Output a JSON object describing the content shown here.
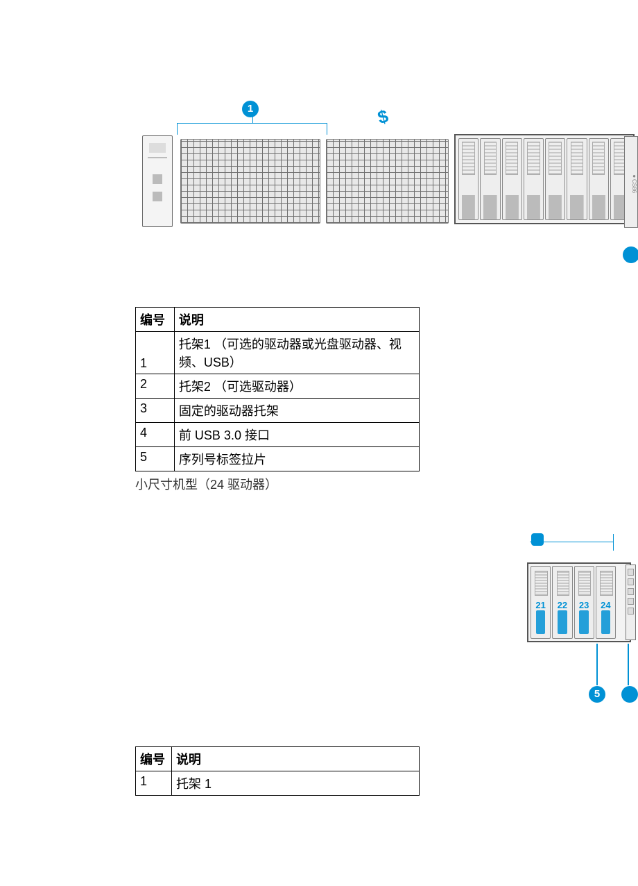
{
  "figure1": {
    "callouts": {
      "c1": "1"
    },
    "dollar_glyph": "$",
    "drive_side_label": "●CS86",
    "drive_slot_count": 8
  },
  "table1": {
    "headers": {
      "num": "编号",
      "desc": "说明"
    },
    "rows": [
      {
        "num": "1",
        "desc": "托架1 （可选的驱动器或光盘驱动器、视频、USB）"
      },
      {
        "num": "2",
        "desc": "托架2 （可选驱动器）"
      },
      {
        "num": "3",
        "desc": "固定的驱动器托架"
      },
      {
        "num": "4",
        "desc": "前 USB 3.0 接口"
      },
      {
        "num": "5",
        "desc": "序列号标签拉片"
      }
    ]
  },
  "caption1": "小尺寸机型（24 驱动器）",
  "figure2": {
    "slot_numbers": [
      "21",
      "22",
      "23",
      "24"
    ],
    "callouts": {
      "c5": "5"
    }
  },
  "table2": {
    "headers": {
      "num": "编号",
      "desc": "说明"
    },
    "rows": [
      {
        "num": "1",
        "desc": "托架 1"
      }
    ]
  }
}
